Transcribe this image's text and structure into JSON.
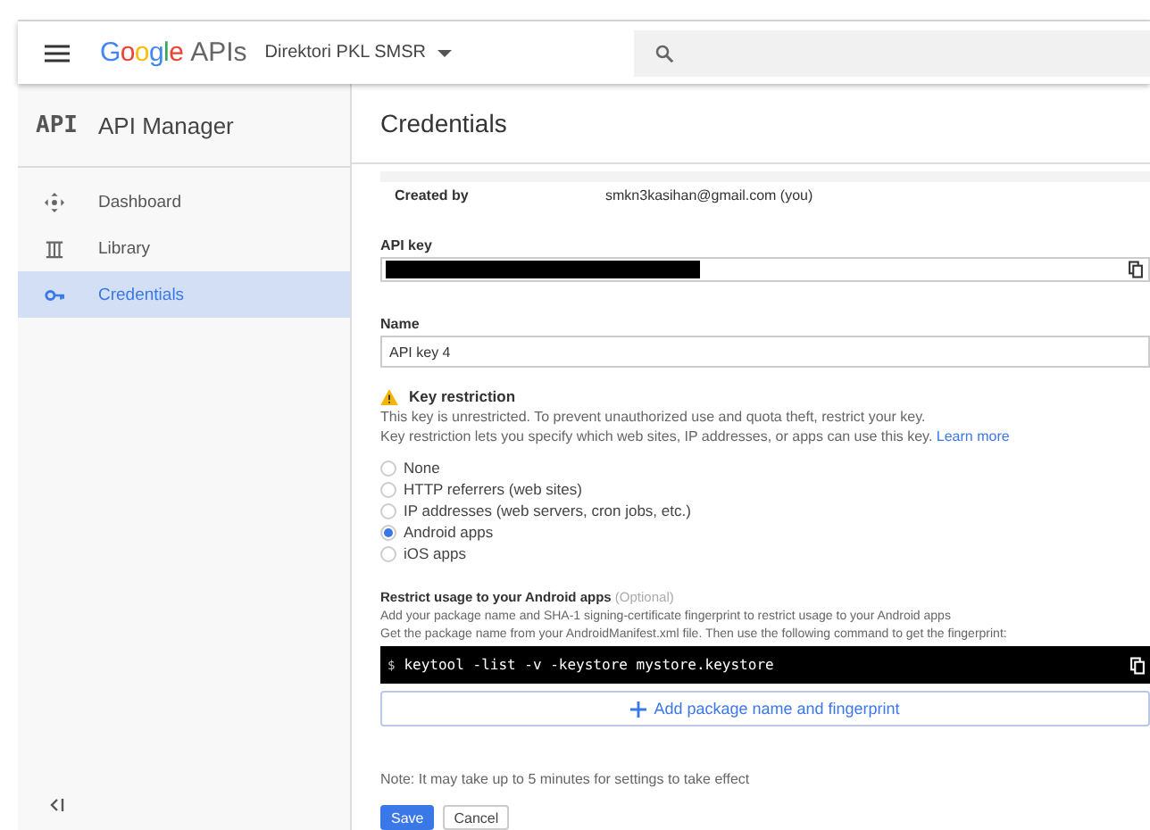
{
  "header": {
    "logo": "Google",
    "product": "APIs",
    "project": "Direktori PKL SMSR"
  },
  "sidebar": {
    "logo": "API",
    "title": "API Manager",
    "items": [
      {
        "label": "Dashboard",
        "selected": false
      },
      {
        "label": "Library",
        "selected": false
      },
      {
        "label": "Credentials",
        "selected": true
      }
    ]
  },
  "page": {
    "title": "Credentials",
    "created_by": {
      "label": "Created by",
      "value": "smkn3kasihan@gmail.com (you)"
    },
    "api_key": {
      "label": "API key"
    },
    "name": {
      "label": "Name",
      "value": "API key 4"
    },
    "restriction": {
      "title": "Key restriction",
      "line_1": "This key is unrestricted. To prevent unauthorized use and quota theft, restrict your key.",
      "line_2": "Key restriction lets you specify which web sites, IP addresses, or apps can use this key.",
      "link": "Learn more",
      "options": [
        {
          "label": "None",
          "selected": false
        },
        {
          "label": "HTTP referrers (web sites)",
          "selected": false
        },
        {
          "label": "IP addresses (web servers, cron jobs, etc.)",
          "selected": false
        },
        {
          "label": "Android apps",
          "selected": true
        },
        {
          "label": "iOS apps",
          "selected": false
        }
      ]
    },
    "android": {
      "title": "Restrict usage to your Android apps",
      "optional": "(Optional)",
      "lines": [
        "Add your package name and SHA-1 signing-certificate fingerprint to restrict usage to your Android apps",
        "Get the package name from your AndroidManifest.xml file. Then use the following command to get the fingerprint:"
      ],
      "prompt": "$",
      "command": "keytool -list -v -keystore mystore.keystore",
      "add_button": "Add package name and fingerprint"
    },
    "note": "Note: It may take up to 5 minutes for settings to take effect",
    "buttons": [
      {
        "label": "Save",
        "kind": "primary"
      },
      {
        "label": "Cancel",
        "kind": "secondary"
      }
    ]
  }
}
